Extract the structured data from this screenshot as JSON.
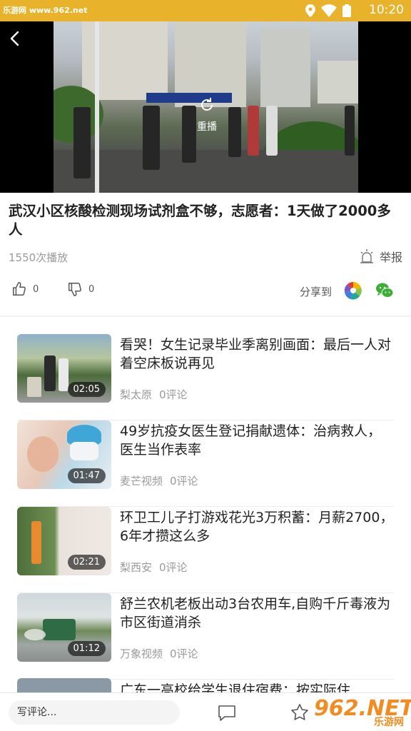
{
  "status_bar": {
    "watermark": "乐游网 www.962.net",
    "time": "10:20",
    "bg_color": "#e8b32b"
  },
  "video": {
    "replay_label": "重播",
    "icons": [
      "back-arrow-icon",
      "replay-icon"
    ]
  },
  "article": {
    "title": "武汉小区核酸检测现场试剂盒不够，志愿者：1天做了2000多人",
    "play_count": "1550次播放",
    "report_label": "举报"
  },
  "actions": {
    "like_count": "0",
    "dislike_count": "0",
    "share_label": "分享到",
    "share_targets": [
      "moments-icon",
      "wechat-icon"
    ]
  },
  "related": [
    {
      "title": "看哭！女生记录毕业季离别画面：最后一人对着空床板说再见",
      "duration": "02:05",
      "source": "梨太原",
      "comments": "0评论"
    },
    {
      "title": "49岁抗疫女医生登记捐献遗体：治病救人，医生当作表率",
      "duration": "01:47",
      "source": "麦芒视频",
      "comments": "0评论"
    },
    {
      "title": "环卫工儿子打游戏花光3万积蓄：月薪2700，6年才攒这么多",
      "duration": "02:21",
      "source": "梨西安",
      "comments": "0评论"
    },
    {
      "title": "舒兰农机老板出动3台农用车,自购千斤毒液为市区街道消杀",
      "duration": "01:12",
      "source": "万象视频",
      "comments": "0评论"
    }
  ],
  "partial_item": {
    "title": "广东一高校给学生退住宿费：按实际住"
  },
  "bottom_bar": {
    "comment_placeholder": "写评论...",
    "brand_top": "962.NET",
    "brand_bottom": "乐游网"
  }
}
